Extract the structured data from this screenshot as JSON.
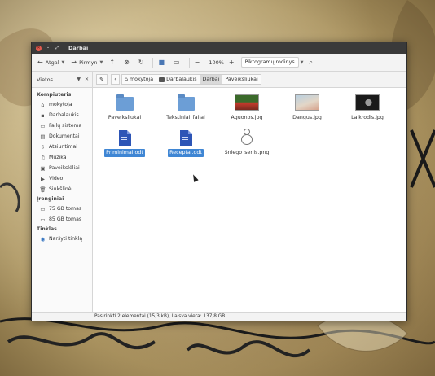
{
  "window": {
    "title": "Darbai"
  },
  "toolbar": {
    "back_label": "Atgal",
    "forward_label": "Pirmyn",
    "zoom": "100%",
    "view_mode": "Piktogramų rodinys"
  },
  "places_header": "Vietos",
  "breadcrumbs": [
    "mokytoja",
    "Darbalaukis",
    "Darbai",
    "Paveiksliukai"
  ],
  "sidebar": {
    "sections": [
      {
        "title": "Kompiuteris",
        "items": [
          {
            "label": "mokytoja",
            "icon": "home-icon"
          },
          {
            "label": "Darbalaukis",
            "icon": "desktop-icon"
          },
          {
            "label": "Failų sistema",
            "icon": "drive-icon"
          },
          {
            "label": "Dokumentai",
            "icon": "documents-icon"
          },
          {
            "label": "Atsiuntimai",
            "icon": "download-icon"
          },
          {
            "label": "Muzika",
            "icon": "music-icon"
          },
          {
            "label": "Paveikslėliai",
            "icon": "pictures-icon"
          },
          {
            "label": "Video",
            "icon": "video-icon"
          },
          {
            "label": "Šiukšlinė",
            "icon": "trash-icon"
          }
        ]
      },
      {
        "title": "Įrenginiai",
        "items": [
          {
            "label": "75 GB tomas",
            "icon": "disk-icon"
          },
          {
            "label": "85 GB tomas",
            "icon": "disk-icon"
          }
        ]
      },
      {
        "title": "Tinklas",
        "items": [
          {
            "label": "Naršyti tinklą",
            "icon": "network-icon"
          }
        ]
      }
    ]
  },
  "files": [
    {
      "name": "Paveiksliukai",
      "type": "folder",
      "selected": false
    },
    {
      "name": "Tekstiniai_failai",
      "type": "folder",
      "selected": false
    },
    {
      "name": "Aguonos.jpg",
      "type": "image",
      "selected": false,
      "colors": [
        "#3b6a2b",
        "#c33a2c"
      ]
    },
    {
      "name": "Dangus.jpg",
      "type": "image",
      "selected": false,
      "colors": [
        "#b9d0e0",
        "#d7a48e"
      ]
    },
    {
      "name": "Laikrodis.jpg",
      "type": "image",
      "selected": false,
      "colors": [
        "#1a1a1a",
        "#9a9a9a"
      ]
    },
    {
      "name": "Priminimai.odt",
      "type": "document",
      "selected": true
    },
    {
      "name": "Receptai.odt",
      "type": "document",
      "selected": true
    },
    {
      "name": "Sniego_senis.png",
      "type": "image-snowman",
      "selected": false
    }
  ],
  "statusbar": "Pasirinkti 2 elementai (15,3 kB), Laisva vieta: 137,8 GB",
  "colors": {
    "selection": "#3f86d4",
    "folder": "#6c9ed6",
    "titlebar": "#3a3a3a"
  }
}
